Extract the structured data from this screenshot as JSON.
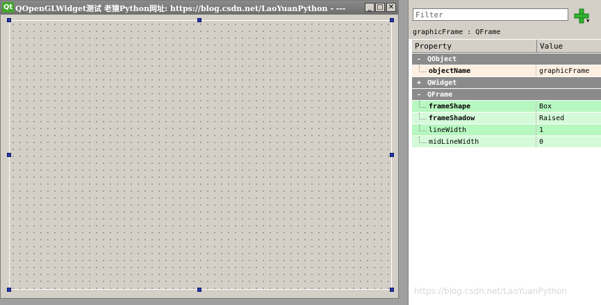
{
  "form": {
    "logo_text": "Qt",
    "title": "QOpenGLWidget测试  老猿Python网址: https://blog.csdn.net/LaoYuanPython - ---",
    "min_label": "_",
    "max_label": "□",
    "close_label": "✕"
  },
  "property_editor": {
    "filter_placeholder": "Filter",
    "filter_value": "",
    "object_label": "graphicFrame : QFrame",
    "header": {
      "property": "Property",
      "value": "Value"
    },
    "groups": [
      {
        "expander": "-",
        "name": "QObject",
        "props": [
          {
            "name": "objectName",
            "value": "graphicFrame",
            "bold": true,
            "color": "#fdf0e1"
          }
        ]
      },
      {
        "expander": "+",
        "name": "QWidget",
        "props": []
      },
      {
        "expander": "-",
        "name": "QFrame",
        "props": [
          {
            "name": "frameShape",
            "value": "Box",
            "bold": true,
            "color": "#b7f7c0"
          },
          {
            "name": "frameShadow",
            "value": "Raised",
            "bold": true,
            "color": "#d5fad9"
          },
          {
            "name": "lineWidth",
            "value": "1",
            "bold": false,
            "color": "#b7f7c0"
          },
          {
            "name": "midLineWidth",
            "value": "0",
            "bold": false,
            "color": "#d5fad9"
          }
        ]
      }
    ]
  },
  "watermark": "https://blog.csdn.net/LaoYuanPython",
  "colors": {
    "accent_green": "#2fb32f",
    "group_bg": "#8b8b8b",
    "canvas_bg": "#d4d0c8"
  }
}
